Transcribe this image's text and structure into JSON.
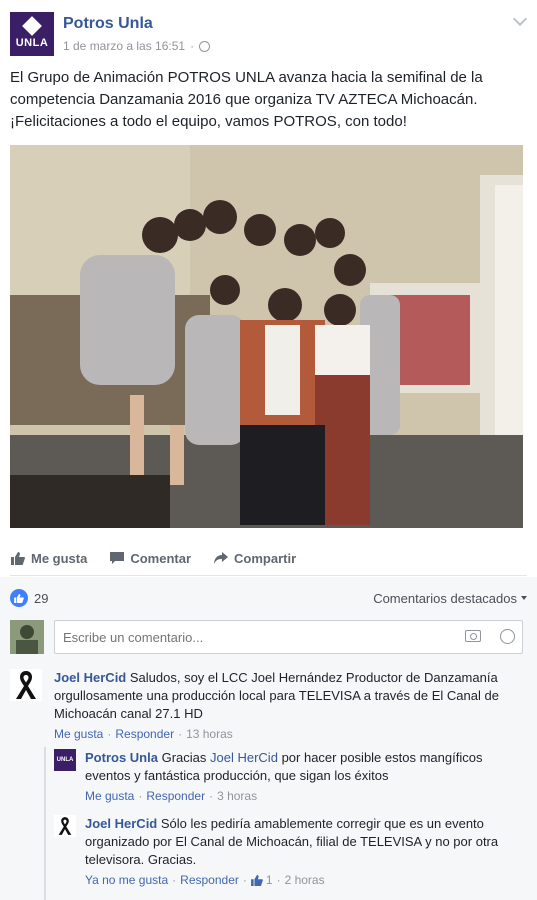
{
  "post": {
    "page_name": "Potros Unla",
    "logo_text": "UNLA",
    "timestamp": "1 de marzo a las 16:51",
    "text": "El Grupo de Animación POTROS UNLA avanza hacia la semifinal de la competencia Danzamania 2016 que organiza TV AZTECA Michoacán. ¡Felicitaciones a todo el equipo, vamos POTROS, con todo!"
  },
  "actions": {
    "like": "Me gusta",
    "comment": "Comentar",
    "share": "Compartir"
  },
  "feedback": {
    "like_count": "29",
    "filter_label": "Comentarios destacados",
    "composer_placeholder": "Escribe un comentario..."
  },
  "comments": [
    {
      "author": "Joel HerCid",
      "text": "Saludos, soy el LCC Joel Hernández Productor de Danzamanía orgullosamente una producción local para TELEVISA a través de El Canal de Michoacán canal 27.1 HD",
      "like_label": "Me gusta",
      "reply_label": "Responder",
      "time": "13 horas"
    }
  ],
  "replies": [
    {
      "author": "Potros Unla",
      "text_before": "Gracias",
      "mention": "Joel HerCid",
      "text_after": "por hacer posible estos mangíficos eventos y fantástica producción, que sigan los éxitos",
      "like_label": "Me gusta",
      "reply_label": "Responder",
      "time": "3 horas"
    },
    {
      "author": "Joel HerCid",
      "text": "Sólo les pediría amablemente corregir que es un evento organizado por El Canal de Michoacán, filial de TELEVISA y no por otra televisora. Gracias.",
      "like_label": "Ya no me gusta",
      "reply_label": "Responder",
      "likes": "1",
      "time": "2 horas"
    }
  ],
  "colors": {
    "link": "#365899",
    "brand": "#3a1f66",
    "like_blue": "#4080ff"
  }
}
